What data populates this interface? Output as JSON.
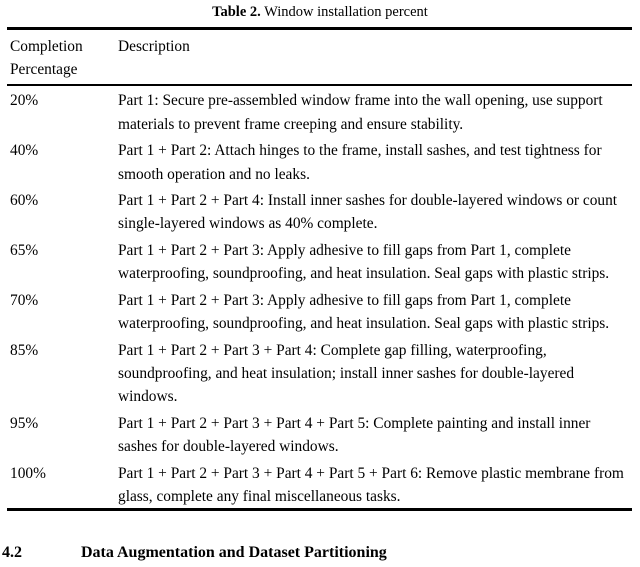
{
  "table": {
    "caption_label": "Table 2.",
    "caption_text": " Window installation percent",
    "headers": {
      "col1_line1": "Completion",
      "col1_line2": "Percentage",
      "col2": "Description"
    },
    "rows": [
      {
        "percent": "20%",
        "description": "Part 1: Secure pre-assembled window frame into the wall opening, use support materials to prevent frame creeping and ensure stability."
      },
      {
        "percent": "40%",
        "description": "Part 1 + Part 2: Attach hinges to the frame, install sashes, and test tightness for smooth operation and no leaks."
      },
      {
        "percent": "60%",
        "description": "Part 1 + Part 2 + Part 4: Install inner sashes for double-layered windows or count single-layered windows as 40% complete."
      },
      {
        "percent": "65%",
        "description": "Part 1 + Part 2 + Part 3: Apply adhesive to fill gaps from Part 1, complete waterproofing, soundproofing, and heat insulation. Seal gaps with plastic strips."
      },
      {
        "percent": "70%",
        "description": "Part 1 + Part 2 + Part 3: Apply adhesive to fill gaps from Part 1, complete waterproofing, soundproofing, and heat insulation. Seal gaps with plastic strips."
      },
      {
        "percent": "85%",
        "description": "Part 1 + Part 2 + Part 3 + Part 4: Complete gap filling, waterproofing, soundproofing, and heat insulation; install inner sashes for double-layered windows."
      },
      {
        "percent": "95%",
        "description": "Part 1 + Part 2 + Part 3 + Part 4 + Part 5: Complete painting and install inner sashes for double-layered windows."
      },
      {
        "percent": "100%",
        "description": "Part 1 + Part 2 + Part 3 + Part 4 + Part 5 + Part 6: Remove plastic membrane from glass, complete any final miscellaneous tasks."
      }
    ]
  },
  "section": {
    "number": "4.2",
    "title": "Data Augmentation and Dataset Partitioning"
  }
}
